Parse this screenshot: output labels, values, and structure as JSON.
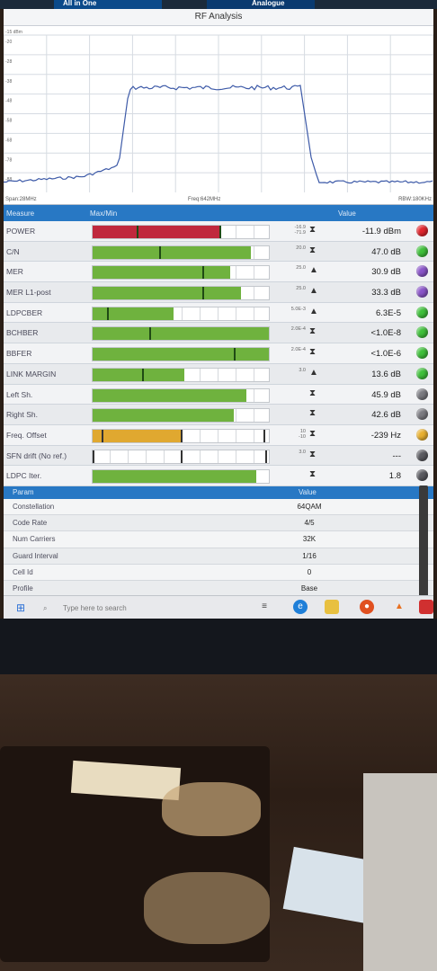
{
  "window": {
    "title": "RF Analysis",
    "tab_left": "All in One",
    "tab_right": "Analogue"
  },
  "spectrum": {
    "ref_level": "-15 dBm",
    "y_ticks": [
      "-20",
      "-28",
      "-38",
      "-48",
      "-58",
      "-68",
      "-78",
      "-88"
    ],
    "span_label": "Span:28MHz",
    "freq_label": "Freq:642MHz",
    "rbw_label": "RBW:180KHz",
    "trace_color": "#3d5aa8"
  },
  "measure_header": {
    "measure": "Measure",
    "maxmin": "Max/Min",
    "value": "Value"
  },
  "measures": [
    {
      "name": "POWER",
      "fill": 0.73,
      "fill_color": "#c0283d",
      "marks": [
        0.25,
        0.72
      ],
      "limit_top": "-16.9",
      "limit_bottom": "-71.9",
      "arrow": "both",
      "value": "-11.9 dBm",
      "led": "#e0262e"
    },
    {
      "name": "C/N",
      "fill": 0.9,
      "fill_color": "#6fb23e",
      "marks": [
        0.38
      ],
      "limit_top": "20.0",
      "limit_bottom": "",
      "arrow": "both",
      "value": "47.0 dB",
      "led": "#3fbf3a"
    },
    {
      "name": "MER",
      "fill": 0.78,
      "fill_color": "#6fb23e",
      "marks": [
        0.62
      ],
      "limit_top": "25.0",
      "limit_bottom": "",
      "arrow": "up",
      "value": "30.9 dB",
      "led": "#8a55c8"
    },
    {
      "name": "MER L1-post",
      "fill": 0.84,
      "fill_color": "#6fb23e",
      "marks": [
        0.62
      ],
      "limit_top": "25.0",
      "limit_bottom": "",
      "arrow": "up",
      "value": "33.3 dB",
      "led": "#8a55c8"
    },
    {
      "name": "LDPCBER",
      "fill": 0.46,
      "fill_color": "#6fb23e",
      "marks": [
        0.08
      ],
      "limit_top": "5.0E-3",
      "limit_bottom": "",
      "arrow": "up",
      "value": "6.3E-5",
      "led": "#3fbf3a"
    },
    {
      "name": "BCHBER",
      "fill": 1.0,
      "fill_color": "#6fb23e",
      "marks": [
        0.32
      ],
      "limit_top": "2.0E-4",
      "limit_bottom": "",
      "arrow": "both",
      "value": "<1.0E-8",
      "led": "#3fbf3a"
    },
    {
      "name": "BBFER",
      "fill": 1.0,
      "fill_color": "#6fb23e",
      "marks": [
        0.8
      ],
      "limit_top": "2.0E-4",
      "limit_bottom": "",
      "arrow": "both",
      "value": "<1.0E-6",
      "led": "#3fbf3a"
    },
    {
      "name": "LINK MARGIN",
      "fill": 0.52,
      "fill_color": "#6fb23e",
      "marks": [
        0.28
      ],
      "limit_top": "3.0",
      "limit_bottom": "",
      "arrow": "up",
      "value": "13.6 dB",
      "led": "#3fbf3a"
    },
    {
      "name": "Left Sh.",
      "fill": 0.87,
      "fill_color": "#6fb23e",
      "marks": [],
      "limit_top": "",
      "limit_bottom": "",
      "arrow": "both",
      "value": "45.9 dB",
      "led": "#7a7a80"
    },
    {
      "name": "Right Sh.",
      "fill": 0.8,
      "fill_color": "#6fb23e",
      "marks": [],
      "limit_top": "",
      "limit_bottom": "",
      "arrow": "both",
      "value": "42.6 dB",
      "led": "#7a7a80"
    },
    {
      "name": "Freq. Offset",
      "fill": 0.5,
      "fill_color": "#e0a830",
      "marks": [
        0.05,
        0.5,
        0.97
      ],
      "limit_top": "10",
      "limit_bottom": "-10",
      "arrow": "both",
      "value": "-239 Hz",
      "led": "#e8b030"
    },
    {
      "name": "SFN drift (No ref.)",
      "fill": 0.0,
      "fill_color": "#6fb23e",
      "marks": [
        0.0,
        0.5,
        0.98
      ],
      "limit_top": "3.0",
      "limit_bottom": "",
      "arrow": "both",
      "value": "---",
      "led": "#5a5a60"
    },
    {
      "name": "LDPC Iter.",
      "fill": 0.93,
      "fill_color": "#6fb23e",
      "marks": [],
      "limit_top": "",
      "limit_bottom": "",
      "arrow": "both",
      "value": "1.8",
      "led": "#5a5a60"
    }
  ],
  "param_header": {
    "param": "Param",
    "value": "Value"
  },
  "params": [
    {
      "name": "Constellation",
      "value": "64QAM"
    },
    {
      "name": "Code Rate",
      "value": "4/5"
    },
    {
      "name": "Num Carriers",
      "value": "32K"
    },
    {
      "name": "Guard Interval",
      "value": "1/16"
    },
    {
      "name": "Cell Id",
      "value": "0"
    },
    {
      "name": "Profile",
      "value": "Base"
    }
  ],
  "taskbar": {
    "search_placeholder": "Type here to search"
  }
}
